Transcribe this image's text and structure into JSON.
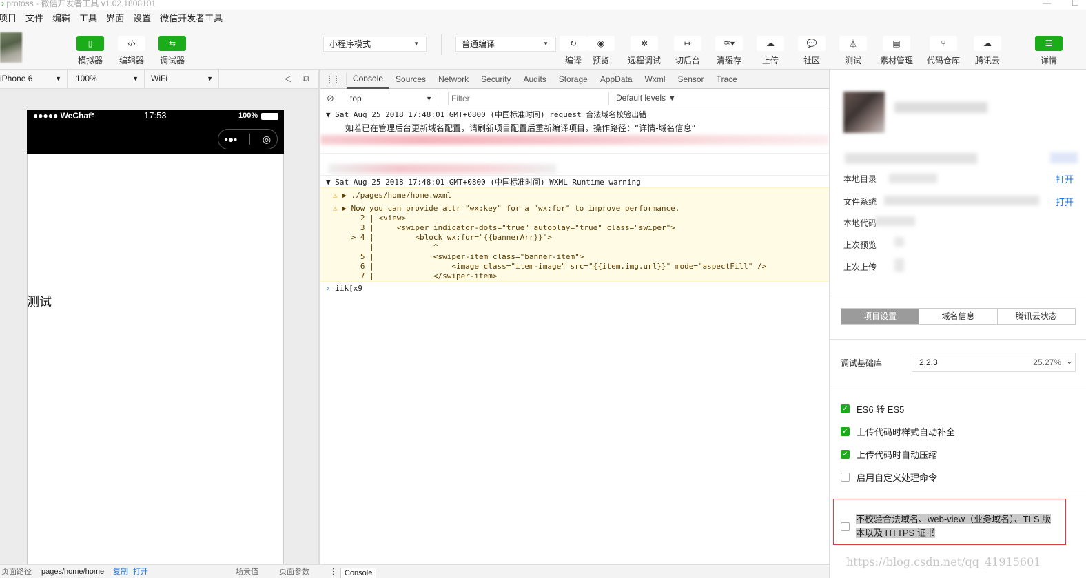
{
  "window": {
    "title": "protoss - 微信开发者工具 v1.02.1808101",
    "controls": [
      "—",
      "☐"
    ]
  },
  "menu": [
    "项目",
    "文件",
    "编辑",
    "工具",
    "界面",
    "设置",
    "微信开发者工具"
  ],
  "toolbar": {
    "simulator": "模拟器",
    "editor": "编辑器",
    "debugger": "调试器",
    "mode": "小程序模式",
    "compile_mode": "普通编译",
    "compile": "编译",
    "preview": "预览",
    "remote_debug": "远程调试",
    "background": "切后台",
    "clear_cache": "清缓存",
    "upload": "上传",
    "community": "社区",
    "test": "测试",
    "assets": "素材管理",
    "repo": "代码仓库",
    "tencent_cloud": "腾讯云",
    "details": "详情"
  },
  "device": {
    "model": "iPhone 6",
    "zoom": "100%",
    "network": "WiFi"
  },
  "phone": {
    "carrier": "●●●●● WeChat",
    "time": "17:53",
    "battery": "100%",
    "content_text": "测试"
  },
  "bottom": {
    "path_label": "页面路径",
    "path": "pages/home/home",
    "copy": "复制",
    "open": "打开",
    "scene": "场景值",
    "params": "页面参数",
    "console_tab": "Console"
  },
  "devtools": {
    "tabs": [
      "Console",
      "Sources",
      "Network",
      "Security",
      "Audits",
      "Storage",
      "AppData",
      "Wxml",
      "Sensor",
      "Trace"
    ],
    "context": "top",
    "filter_placeholder": "Filter",
    "levels": "Default levels ▼",
    "log1_header": "Sat Aug 25 2018 17:48:01 GMT+0800 (中国标准时间) request 合法域名校验出错",
    "log1_body": "如若已在管理后台更新域名配置，请刷新项目配置后重新编译项目，操作路径：“详情-域名信息”",
    "log2_header": "Sat Aug 25 2018 17:48:01 GMT+0800 (中国标准时间) WXML Runtime warning",
    "warn_path": "▶ ./pages/home/home.wxml",
    "warn_msg": "▶ Now you can provide attr \"wx:key\" for a \"wx:for\" to improve performance.",
    "code": [
      "   2 | <view>",
      "   3 |     <swiper indicator-dots=\"true\" autoplay=\"true\" class=\"swiper\">",
      " > 4 |         <block wx:for=\"{{bannerArr}}\">",
      "     |             ^",
      "   5 |             <swiper-item class=\"banner-item\">",
      "   6 |                 <image class=\"item-image\" src=\"{{item.img.url}}\" mode=\"aspectFill\" />",
      "   7 |             </swiper-item>"
    ],
    "prompt_input": "iik[x9"
  },
  "details": {
    "local_dir_label": "本地目录",
    "open": "打开",
    "fs_label": "文件系统",
    "local_code_label": "本地代码",
    "last_preview_label": "上次预览",
    "last_upload_label": "上次上传",
    "tabs": [
      "项目设置",
      "域名信息",
      "腾讯云状态"
    ],
    "lib_label": "调试基础库",
    "lib_version": "2.2.3",
    "lib_usage": "25.27%",
    "options": [
      {
        "label": "ES6 转 ES5",
        "checked": true
      },
      {
        "label": "上传代码时样式自动补全",
        "checked": true
      },
      {
        "label": "上传代码时自动压缩",
        "checked": true
      },
      {
        "label": "启用自定义处理命令",
        "checked": false
      }
    ],
    "skip_verify": "不校验合法域名、web-view（业务域名）、TLS 版本以及 HTTPS 证书"
  },
  "watermark": "https://blog.csdn.net/qq_41915601",
  "colors": {
    "accent_green": "#1aad19",
    "link_blue": "#1a73e8",
    "warning_bg": "#fffbe5",
    "highlight_red": "#e23b3b"
  }
}
